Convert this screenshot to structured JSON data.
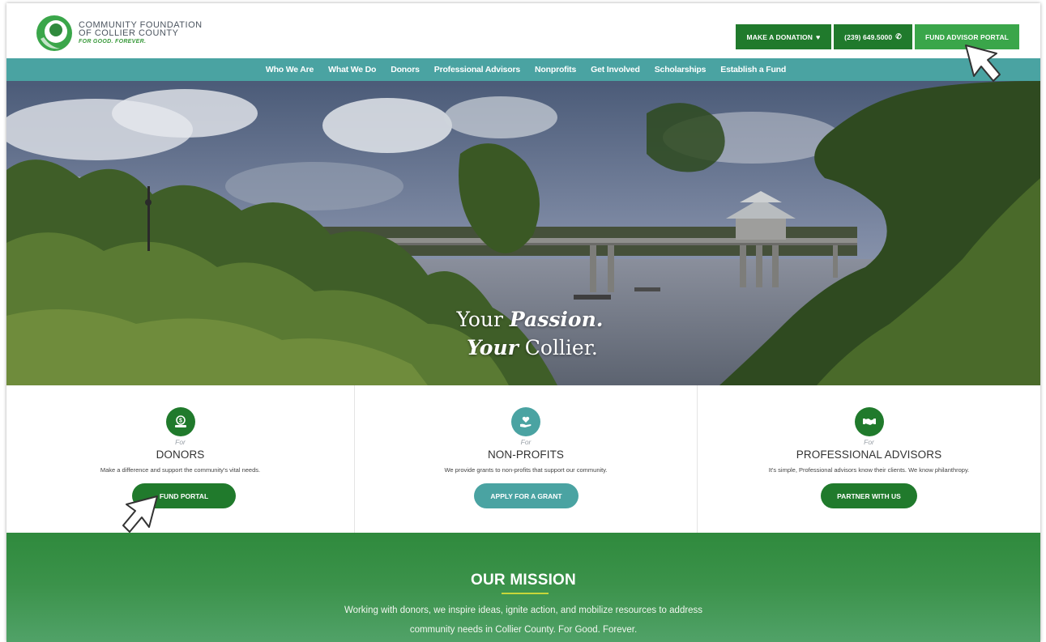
{
  "logo": {
    "line1": "COMMUNITY FOUNDATION",
    "line2": "OF COLLIER COUNTY",
    "tagline": "FOR GOOD. FOREVER."
  },
  "header_buttons": {
    "donate_label": "MAKE A DONATION",
    "phone_label": "(239) 649.5000",
    "portal_label": "FUND ADVISOR PORTAL"
  },
  "nav": {
    "items": [
      "Who We Are",
      "What We Do",
      "Donors",
      "Professional Advisors",
      "Nonprofits",
      "Get Involved",
      "Scholarships",
      "Establish a Fund"
    ]
  },
  "hero": {
    "line1_a": "Your ",
    "line1_b": "Passion.",
    "line2_a": "Your",
    "line2_b": " Collier."
  },
  "cards": [
    {
      "for": "For",
      "title": "DONORS",
      "desc": "Make a difference and support the community's vital needs.",
      "button": "FUND PORTAL",
      "icon": "money-hand-icon",
      "color": "#207a2c"
    },
    {
      "for": "For",
      "title": "NON-PROFITS",
      "desc": "We provide grants to non-profits that support our community.",
      "button": "APPLY FOR A GRANT",
      "icon": "heart-hand-icon",
      "color": "#4aa3a2"
    },
    {
      "for": "For",
      "title": "PROFESSIONAL ADVISORS",
      "desc": "It's simple, Professional advisors know their clients. We know philanthropy.",
      "button": "PARTNER WITH US",
      "icon": "handshake-icon",
      "color": "#207a2c"
    }
  ],
  "mission": {
    "title": "OUR MISSION",
    "line1": "Working with donors, we inspire ideas, ignite action, and mobilize resources to address",
    "line2": "community needs in Collier County. For Good. Forever."
  },
  "colors": {
    "dark_green": "#207a2c",
    "light_green": "#3aa64a",
    "teal": "#4aa3a2",
    "accent_rule": "#c7d63a"
  }
}
